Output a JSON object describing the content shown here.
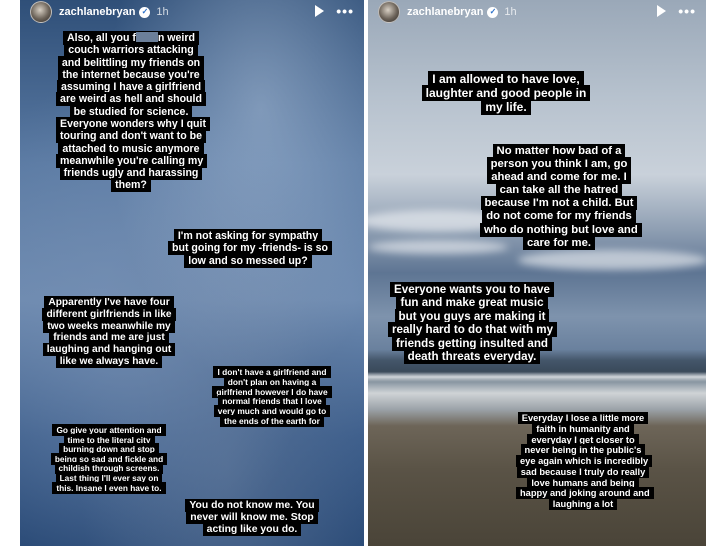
{
  "stories": {
    "left": {
      "username": "zachlanebryan",
      "time": "1h",
      "captions": {
        "c1": {
          "pre": "Also, all you f",
          "post": "n weird couch warriors attacking and belittling my friends on the internet because you're assuming I have a girlfriend are weird as hell and should be studied for science. Everyone wonders why I quit touring and don't want to be attached to music anymore meanwhile you're calling my friends ugly and harassing them?"
        },
        "c2": "I'm not asking for sympathy but going for my -friends- is so low and so messed up?",
        "c3": "Apparently I've have four different girlfriends in like two weeks meanwhile my friends and me are just laughing and hanging out like we always have.",
        "c4": "I don't have a girlfriend and don't plan on having a girlfriend however I do have normal friends that I love very much and would go to the ends of the earth for",
        "c5": "Go give your attention and time to the literal city burning down and stop being so sad and fickle and childish through screens. Last thing I'll ever say on this. Insane I even have to.",
        "c6": "You do not know me. You never will know me. Stop acting like you do."
      }
    },
    "right": {
      "username": "zachlanebryan",
      "time": "1h",
      "captions": {
        "c1": "I am allowed to have love, laughter and good people in my life.",
        "c2": "No matter how bad of a person you think I am, go ahead and come for me. I can take all the hatred because I'm not a child. But do not come for my friends who do nothing but love and care for me.",
        "c3": "Everyone wants you to have fun and make great music but you guys are making it really hard to do that with my friends getting insulted and death threats everyday.",
        "c4": "Everyday I lose a little more faith in humanity and everyday I get closer to never being in the public's eye again which is incredibly sad because I truly do really love humans and being happy and joking around and laughing a lot"
      }
    }
  },
  "icons": {
    "verified": "verified-badge-icon",
    "play": "play-icon",
    "more": "more-options-icon"
  },
  "colors": {
    "caption_bg": "#000000",
    "caption_text": "#ffffff",
    "verified": "#2b70c9"
  }
}
